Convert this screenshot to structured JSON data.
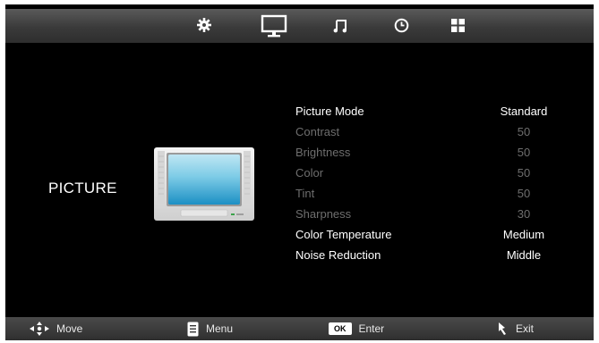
{
  "topbar": {
    "icons": [
      "settings-gear-icon",
      "picture-monitor-icon",
      "sound-note-icon",
      "time-clock-icon",
      "apps-grid-icon"
    ],
    "selected": "picture-monitor-icon"
  },
  "category": {
    "title": "PICTURE"
  },
  "menu": {
    "items": [
      {
        "label": "Picture Mode",
        "value": "Standard",
        "enabled": true
      },
      {
        "label": "Contrast",
        "value": "50",
        "enabled": false
      },
      {
        "label": "Brightness",
        "value": "50",
        "enabled": false
      },
      {
        "label": "Color",
        "value": "50",
        "enabled": false
      },
      {
        "label": "Tint",
        "value": "50",
        "enabled": false
      },
      {
        "label": "Sharpness",
        "value": "30",
        "enabled": false
      },
      {
        "label": "Color Temperature",
        "value": "Medium",
        "enabled": true
      },
      {
        "label": "Noise Reduction",
        "value": "Middle",
        "enabled": true
      }
    ]
  },
  "bottombar": {
    "move": "Move",
    "menu": "Menu",
    "ok_key": "OK",
    "enter": "Enter",
    "exit": "Exit"
  },
  "colors": {
    "background": "#000000",
    "enabled_text": "#ffffff",
    "disabled_text": "#6e6e6e",
    "bar_top": "#5a5a5a"
  }
}
